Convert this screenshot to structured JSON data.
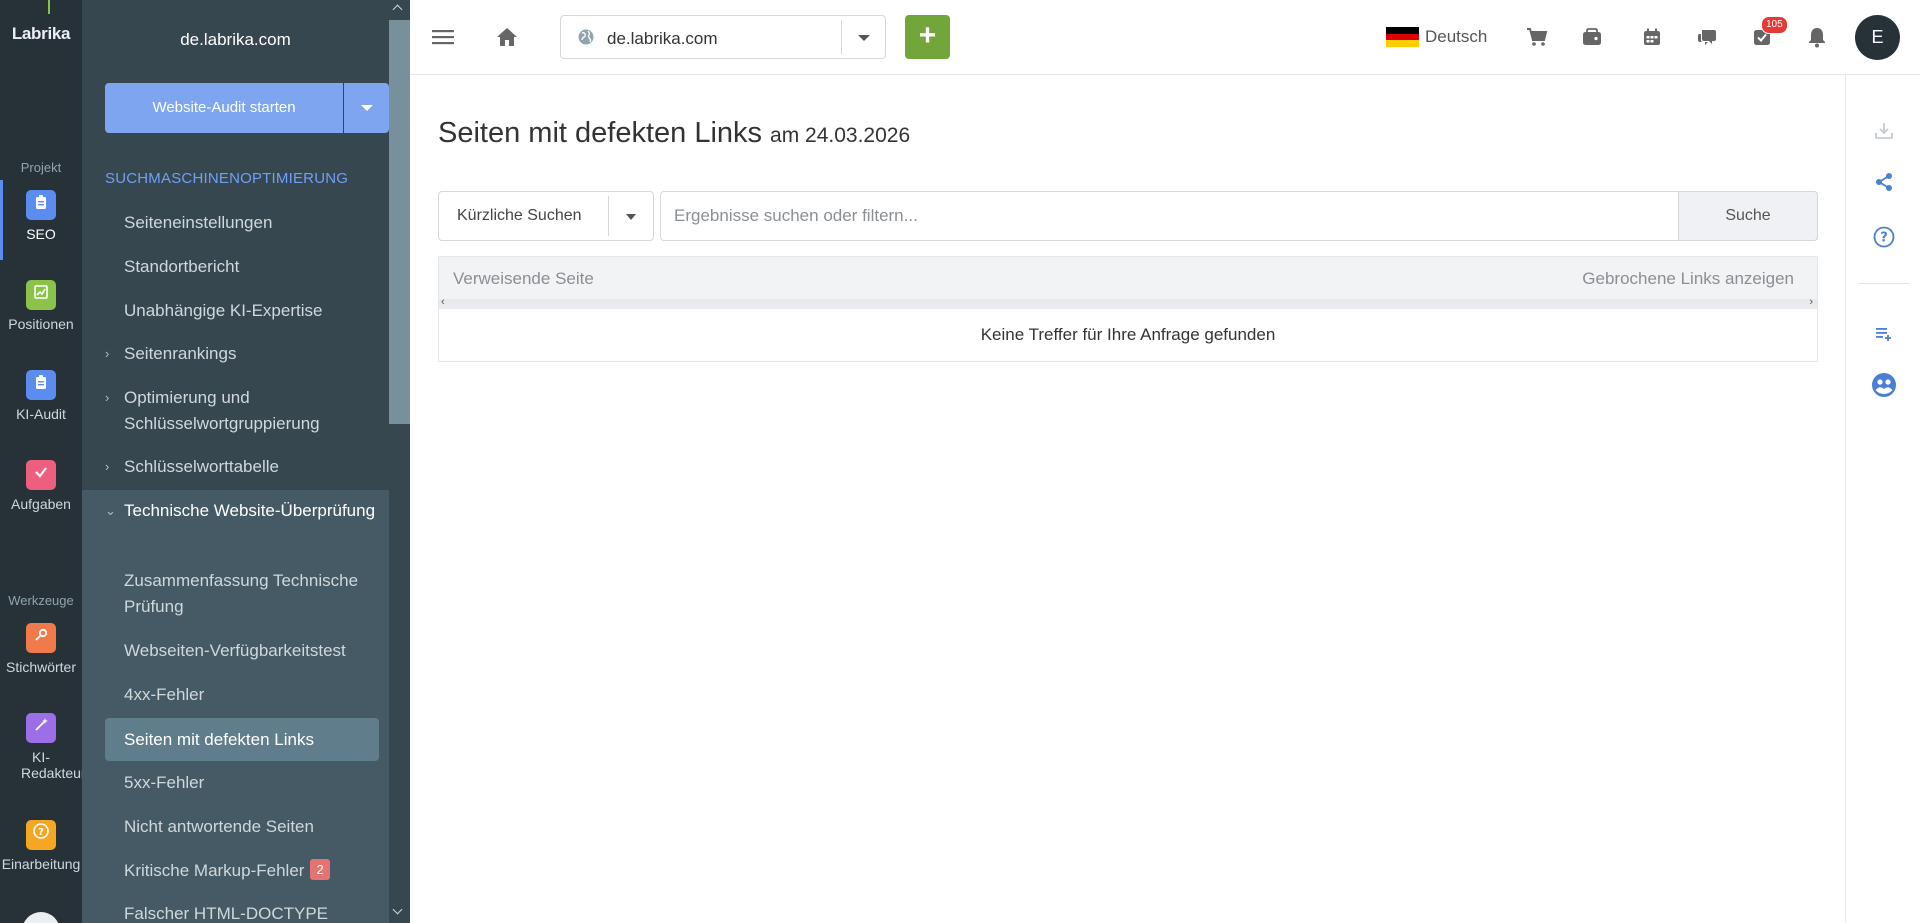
{
  "rail": {
    "logo": "Labrika",
    "project_label": "Projekt",
    "tools_label": "Werkzeuge",
    "items": [
      {
        "label": "SEO",
        "icon": "clipboard-icon",
        "color": "#5b8def"
      },
      {
        "label": "Positionen",
        "icon": "chart-icon",
        "color": "#8bc34a"
      },
      {
        "label": "KI-Audit",
        "icon": "clipboard-icon",
        "color": "#5b8def"
      },
      {
        "label": "Aufgaben",
        "icon": "check-icon",
        "color": "#ec5f7e"
      },
      {
        "label": "Stichwörter",
        "icon": "key-icon",
        "color": "#f07a4a"
      },
      {
        "label": "KI-Redakteur",
        "icon": "magic-wand-icon",
        "color": "#9c6ee8"
      },
      {
        "label": "Einarbeitung",
        "icon": "help-icon",
        "color": "#f5a623"
      }
    ]
  },
  "sidebar": {
    "domain": "de.labrika.com",
    "audit_button": "Website-Audit starten",
    "section_title": "SUCHMASCHINENOPTIMIERUNG",
    "items": [
      {
        "label": "Seiteneinstellungen"
      },
      {
        "label": "Standortbericht"
      },
      {
        "label": "Unabhängige KI-Expertise"
      },
      {
        "label": "Seitenrankings"
      },
      {
        "label": "Optimierung und Schlüsselwortgruppierung"
      },
      {
        "label": "Schlüsselworttabelle"
      },
      {
        "label": "Technische Website-Überprüfung"
      },
      {
        "label": "Zusammenfassung Technische Prüfung"
      },
      {
        "label": "Webseiten-Verfügbarkeitstest"
      },
      {
        "label": "4xx-Fehler"
      },
      {
        "label": "Seiten mit defekten Links"
      },
      {
        "label": "5xx-Fehler"
      },
      {
        "label": "Nicht antwortende Seiten"
      },
      {
        "label": "Kritische Markup-Fehler",
        "badge": "2"
      },
      {
        "label": "Falscher HTML-DOCTYPE"
      }
    ]
  },
  "topbar": {
    "domain": "de.labrika.com",
    "add_label": "+",
    "language": "Deutsch",
    "tasks_count": "105",
    "avatar_initial": "E"
  },
  "main": {
    "title": "Seiten mit defekten Links",
    "date": "am 24.03.2026",
    "recent_searches": "Kürzliche Suchen",
    "search_placeholder": "Ergebnisse suchen oder filtern...",
    "search_button": "Suche",
    "columns": [
      "Verweisende Seite",
      "Gebrochene Links anzeigen"
    ],
    "empty_message": "Keine Treffer für Ihre Anfrage gefunden"
  },
  "colors": {
    "accent_blue": "#5b8def",
    "add_green": "#73a63a",
    "sidebar_bg": "#37474f",
    "rail_bg": "#263238"
  }
}
